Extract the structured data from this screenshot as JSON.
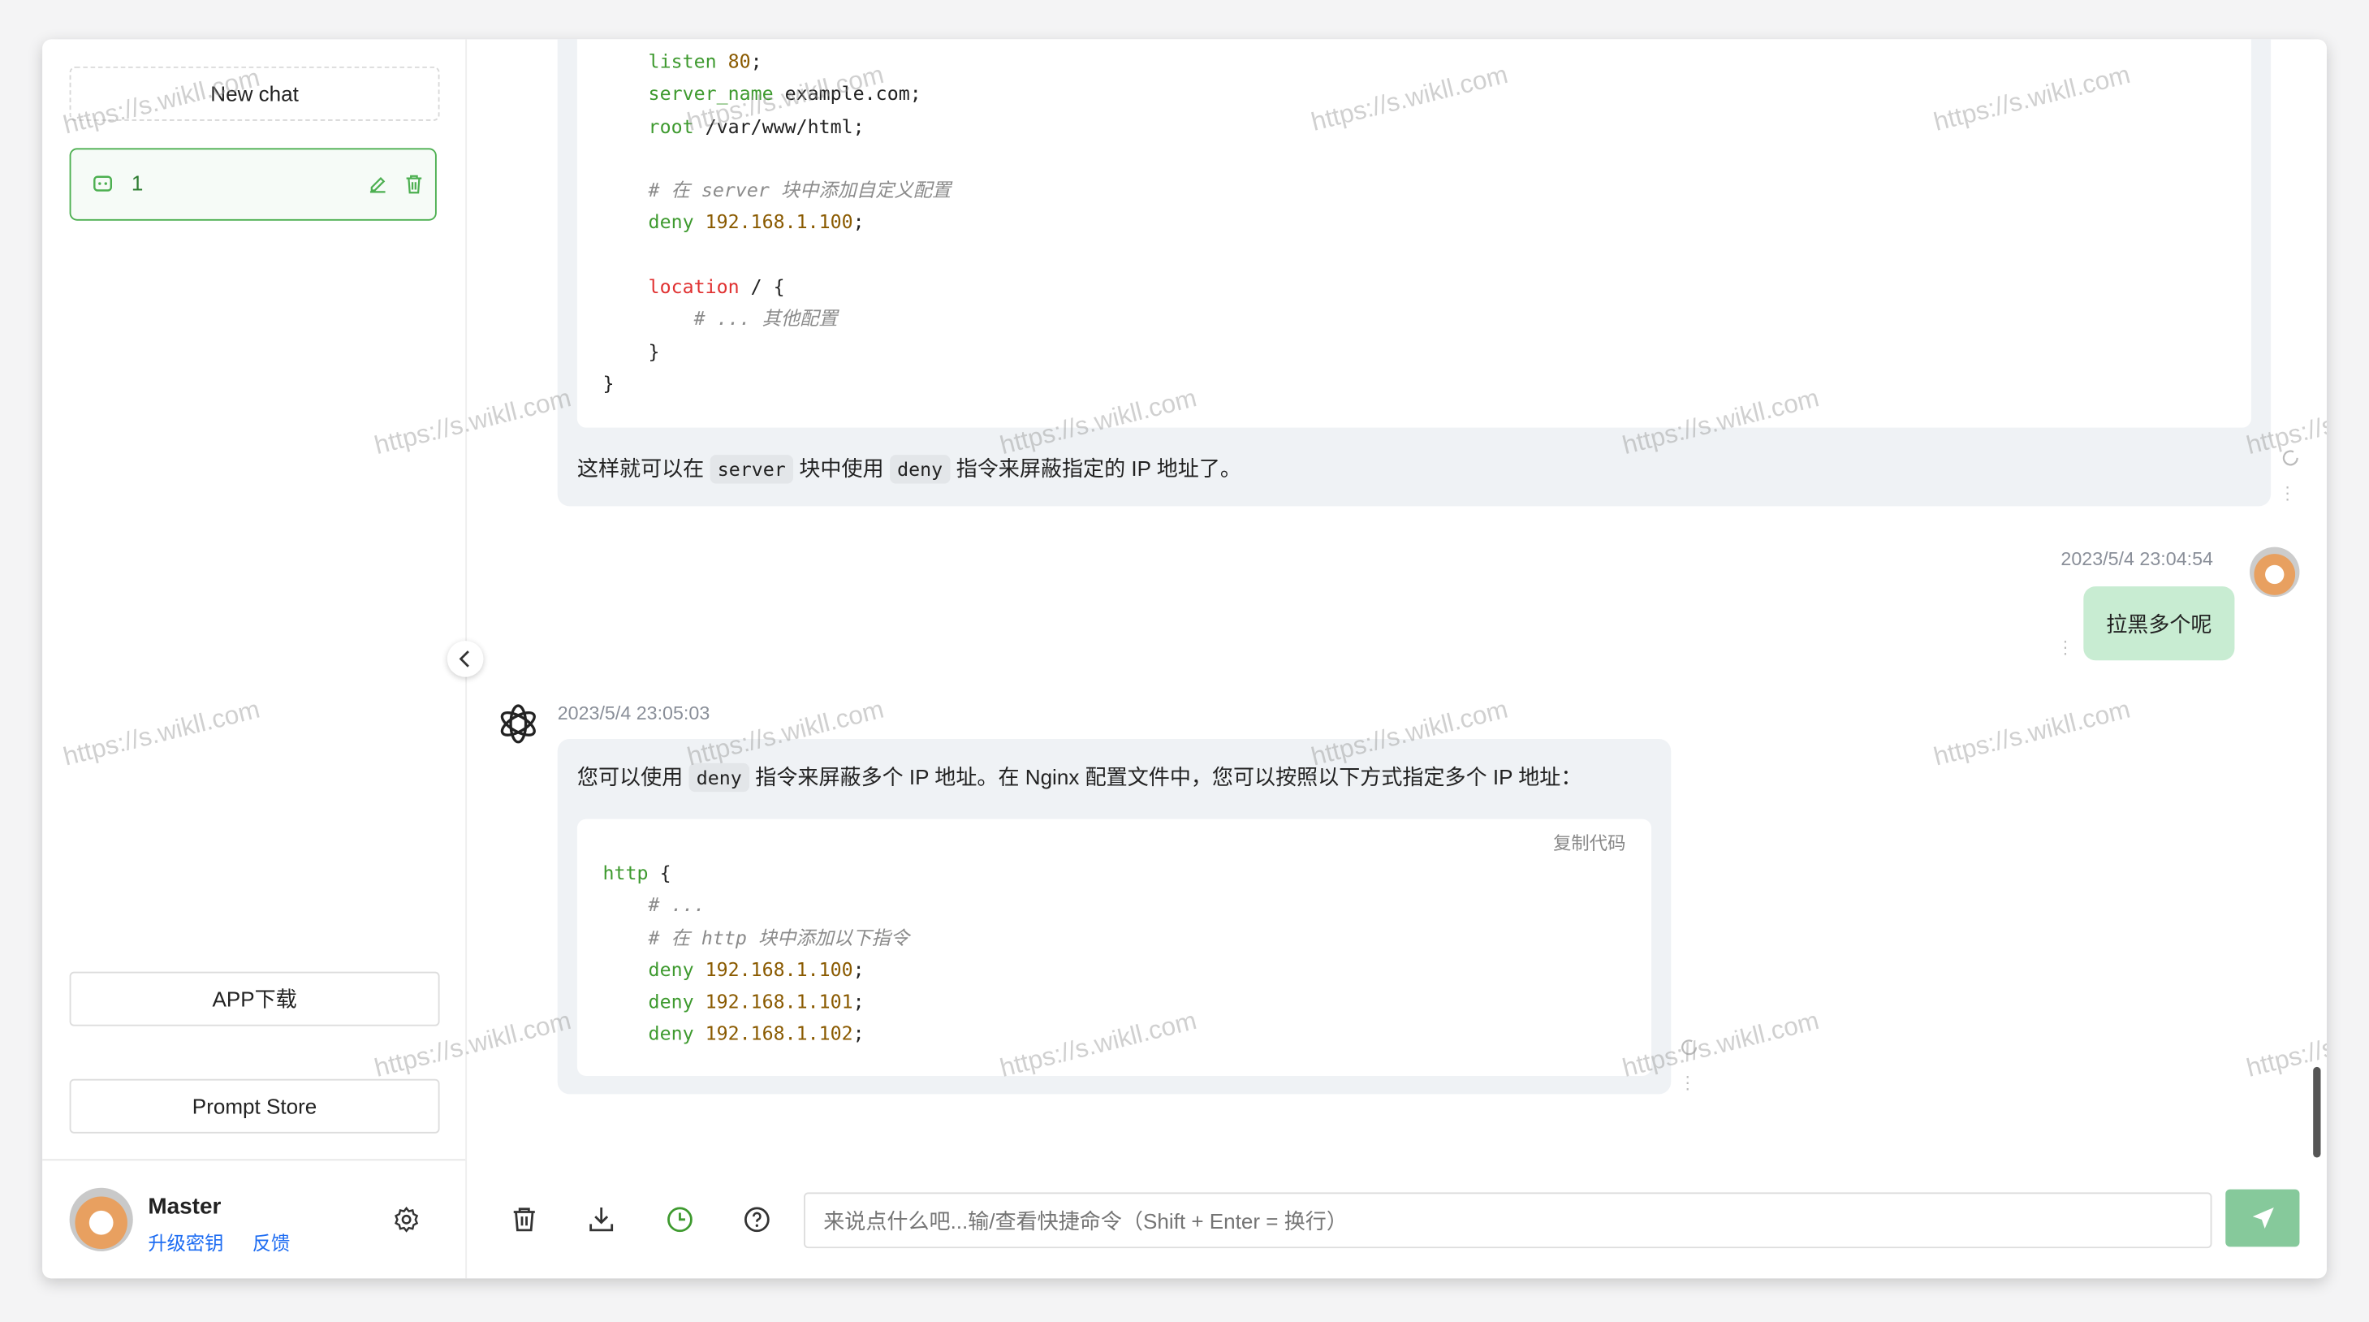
{
  "sidebar": {
    "new_chat_label": "New chat",
    "chats": [
      {
        "title": "1"
      }
    ],
    "app_download_label": "APP下载",
    "prompt_store_label": "Prompt Store",
    "user": {
      "name": "Master",
      "upgrade_link": "升级密钥",
      "feedback_link": "反馈"
    }
  },
  "messages": [
    {
      "role": "assistant",
      "code_lines": [
        [
          {
            "t": "    listen ",
            "c": "kw"
          },
          {
            "t": "80",
            "c": "num"
          },
          {
            "t": ";",
            "c": "plain"
          }
        ],
        [
          {
            "t": "    server_name ",
            "c": "kw"
          },
          {
            "t": "example.com;",
            "c": "plain"
          }
        ],
        [
          {
            "t": "    root ",
            "c": "kw"
          },
          {
            "t": "/var/www/html;",
            "c": "plain"
          }
        ],
        [
          {
            "t": "",
            "c": "plain"
          }
        ],
        [
          {
            "t": "    # 在 server 块中添加自定义配置",
            "c": "cm"
          }
        ],
        [
          {
            "t": "    deny ",
            "c": "kw"
          },
          {
            "t": "192.168.1.100",
            "c": "num"
          },
          {
            "t": ";",
            "c": "plain"
          }
        ],
        [
          {
            "t": "",
            "c": "plain"
          }
        ],
        [
          {
            "t": "    location",
            "c": "red"
          },
          {
            "t": " / {",
            "c": "plain"
          }
        ],
        [
          {
            "t": "        # ... 其他配置",
            "c": "cm"
          }
        ],
        [
          {
            "t": "    }",
            "c": "plain"
          }
        ],
        [
          {
            "t": "}",
            "c": "plain"
          }
        ]
      ],
      "text_parts": [
        "这样就可以在 ",
        "server",
        " 块中使用 ",
        "deny",
        " 指令来屏蔽指定的 IP 地址了。"
      ]
    },
    {
      "role": "user",
      "timestamp": "2023/5/4 23:04:54",
      "text": "拉黑多个呢"
    },
    {
      "role": "assistant",
      "timestamp": "2023/5/4 23:05:03",
      "text_parts": [
        "您可以使用 ",
        "deny",
        " 指令来屏蔽多个 IP 地址。在 Nginx 配置文件中，您可以按照以下方式指定多个 IP 地址："
      ],
      "copy_label": "复制代码",
      "code_lines": [
        [
          {
            "t": "http",
            "c": "kw"
          },
          {
            "t": " {",
            "c": "plain"
          }
        ],
        [
          {
            "t": "    # ...",
            "c": "cm"
          }
        ],
        [
          {
            "t": "    # 在 http 块中添加以下指令",
            "c": "cm"
          }
        ],
        [
          {
            "t": "    deny ",
            "c": "kw"
          },
          {
            "t": "192.168.1.100",
            "c": "num"
          },
          {
            "t": ";",
            "c": "plain"
          }
        ],
        [
          {
            "t": "    deny ",
            "c": "kw"
          },
          {
            "t": "192.168.1.101",
            "c": "num"
          },
          {
            "t": ";",
            "c": "plain"
          }
        ],
        [
          {
            "t": "    deny ",
            "c": "kw"
          },
          {
            "t": "192.168.1.102",
            "c": "num"
          },
          {
            "t": ";",
            "c": "plain"
          }
        ]
      ]
    }
  ],
  "composer": {
    "placeholder": "来说点什么吧...输/查看快捷命令（Shift + Enter = 换行）"
  },
  "watermark": "https://s.wikll.com",
  "colors": {
    "accent": "#4caf50",
    "user_bubble": "#c8ecd2",
    "send_button": "#86c99b",
    "link": "#1d6cf2"
  }
}
